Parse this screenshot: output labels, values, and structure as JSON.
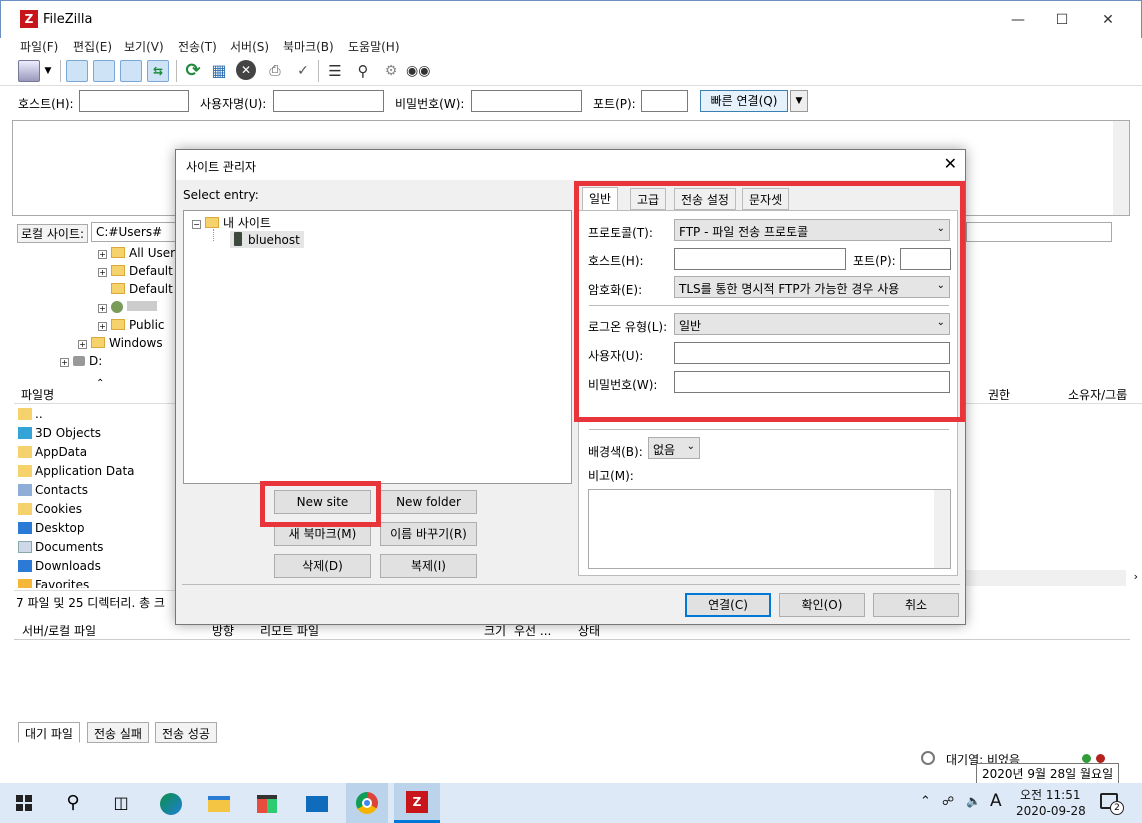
{
  "window": {
    "title": "FileZilla",
    "icon": "filezilla-icon"
  },
  "menu": [
    "파일(F)",
    "편집(E)",
    "보기(V)",
    "전송(T)",
    "서버(S)",
    "북마크(B)",
    "도움말(H)"
  ],
  "quickconnect": {
    "host_label": "호스트(H):",
    "user_label": "사용자명(U):",
    "pass_label": "비밀번호(W):",
    "port_label": "포트(P):",
    "connect_label": "빠른 연결(Q)"
  },
  "local": {
    "label": "로컬 사이트:",
    "path": "C:#Users#",
    "tree": [
      "All User",
      "Default",
      "Default",
      "",
      "Public",
      "Windows",
      "D:"
    ],
    "file_header": "파일명",
    "files": [
      "..",
      "3D Objects",
      "AppData",
      "Application Data",
      "Contacts",
      "Cookies",
      "Desktop",
      "Documents",
      "Downloads",
      "Favorites"
    ],
    "status": "7 파일 및 25 디렉터리. 총 크"
  },
  "remote": {
    "headers": [
      "권한",
      "소유자/그룹"
    ]
  },
  "queue": {
    "headers": [
      "서버/로컬 파일",
      "방향",
      "리모트 파일",
      "크기",
      "우선 ...",
      "상태"
    ],
    "tabs": [
      "대기 파일",
      "전송 실패",
      "전송 성공"
    ],
    "status": "대기열: 비었음"
  },
  "dialog": {
    "title": "사이트 관리자",
    "select_label": "Select entry:",
    "tree": {
      "root": "내 사이트",
      "site": "bluehost"
    },
    "buttons": {
      "new_site": "New site",
      "new_folder": "New folder",
      "new_bookmark": "새 북마크(M)",
      "rename": "이름 바꾸기(R)",
      "delete": "삭제(D)",
      "copy": "복제(I)",
      "connect": "연결(C)",
      "ok": "확인(O)",
      "cancel": "취소"
    },
    "tabs": [
      "일반",
      "고급",
      "전송 설정",
      "문자셋"
    ],
    "fields": {
      "protocol_label": "프로토콜(T):",
      "protocol_value": "FTP - 파일 전송 프로토콜",
      "host_label": "호스트(H):",
      "port_label": "포트(P):",
      "encryption_label": "암호화(E):",
      "encryption_value": "TLS를 통한 명시적 FTP가 가능한 경우 사용",
      "logon_label": "로그온 유형(L):",
      "logon_value": "일반",
      "user_label": "사용자(U):",
      "password_label": "비밀번호(W):",
      "bgcolor_label": "배경색(B):",
      "bgcolor_value": "없음",
      "comment_label": "비고(M):"
    }
  },
  "taskbar": {
    "time": "오전 11:51",
    "date": "2020-09-28",
    "tooltip": "2020년 9월 28일 월요일",
    "ime": "A",
    "notifications": "2"
  },
  "colors": {
    "highlight": "#e8353c",
    "accent": "#0078d7",
    "taskbar": "#dde9f6"
  }
}
